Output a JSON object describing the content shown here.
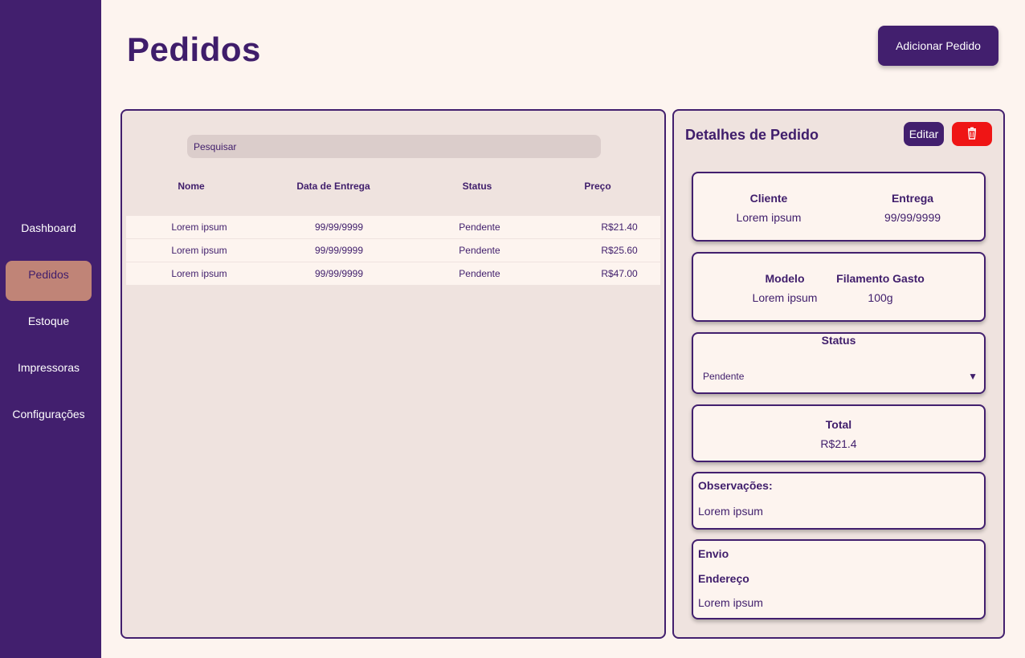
{
  "sidebar": {
    "items": [
      {
        "label": "Dashboard",
        "active": false
      },
      {
        "label": "Pedidos",
        "active": true
      },
      {
        "label": "Estoque",
        "active": false
      },
      {
        "label": "Impressoras",
        "active": false
      },
      {
        "label": "Configurações",
        "active": false
      }
    ]
  },
  "header": {
    "title": "Pedidos",
    "add_button": "Adicionar Pedido"
  },
  "list": {
    "search_placeholder": "Pesquisar",
    "columns": [
      "Nome",
      "Data de Entrega",
      "Status",
      "Preço"
    ],
    "rows": [
      [
        "Lorem ipsum",
        "99/99/9999",
        "Pendente",
        "R$21.40"
      ],
      [
        "Lorem ipsum",
        "99/99/9999",
        "Pendente",
        "R$25.60"
      ],
      [
        "Lorem ipsum",
        "99/99/9999",
        "Pendente",
        "R$47.00"
      ]
    ]
  },
  "detail": {
    "title": "Detalhes de Pedido",
    "edit_button": "Editar",
    "delete_icon": "trash-icon",
    "client_label": "Cliente",
    "client_value": "Lorem ipsum",
    "delivery_label": "Entrega",
    "delivery_value": "99/99/9999",
    "model_label": "Modelo",
    "model_value": "Lorem ipsum",
    "filament_label": "Filamento Gasto",
    "filament_value": "100g",
    "status_label": "Status",
    "status_value": "Pendente",
    "total_label": "Total",
    "total_value": "R$21.4",
    "notes_label": "Observações:",
    "notes_value": "Lorem ipsum",
    "shipping_label": "Envio",
    "address_label": "Endereço",
    "address_value": "Lorem ipsum"
  },
  "colors": {
    "primary": "#421f6e",
    "background": "#fdf4ef",
    "panel": "#efe3df",
    "active_nav": "#c08477",
    "danger": "#ef1515"
  }
}
